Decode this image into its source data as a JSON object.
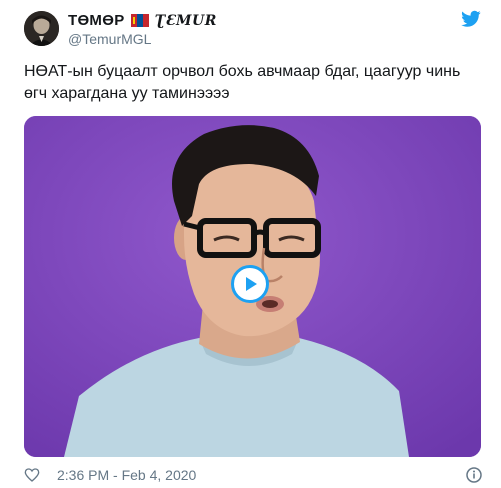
{
  "tweet": {
    "display_name": "ТӨМӨР",
    "gothic_name": "ƮƐMUR",
    "handle": "@TemurMGL",
    "text": "НӨАТ-ын буцаалт орчвол бохь авчмаар бдаг, цаагуур чинь өгч харагдана уу таминээээ",
    "timestamp": "2:36 PM - Feb 4, 2020"
  },
  "icons": {
    "brand": "twitter-bird-icon",
    "like": "heart-icon",
    "info": "info-icon",
    "play": "play-icon",
    "flag": "mongolia-flag-icon"
  },
  "colors": {
    "accent": "#1da1f2",
    "video_bg": "#7b43b8",
    "secondary_text": "#657786"
  }
}
